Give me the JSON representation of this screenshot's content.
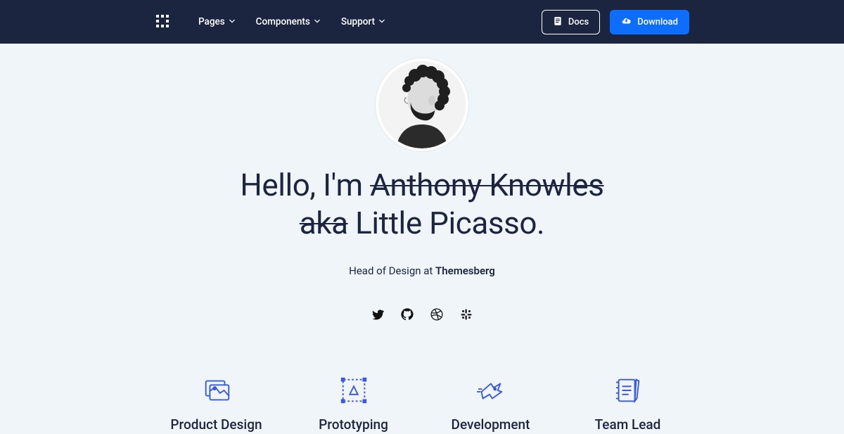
{
  "nav": {
    "items": [
      "Pages",
      "Components",
      "Support"
    ],
    "docs_label": "Docs",
    "download_label": "Download"
  },
  "hero": {
    "prefix": "Hello, I'm ",
    "strike1": "Anthony Knowles",
    "strike2": "aka",
    "suffix": " Little Picasso.",
    "subtitle_prefix": "Head of Design at ",
    "subtitle_company": "Themesberg"
  },
  "socials": [
    "twitter",
    "github",
    "dribbble",
    "slack"
  ],
  "features": [
    {
      "title": "Product Design",
      "icon": "product-design"
    },
    {
      "title": "Prototyping",
      "icon": "prototyping"
    },
    {
      "title": "Development",
      "icon": "development"
    },
    {
      "title": "Team Lead",
      "icon": "team-lead"
    }
  ]
}
